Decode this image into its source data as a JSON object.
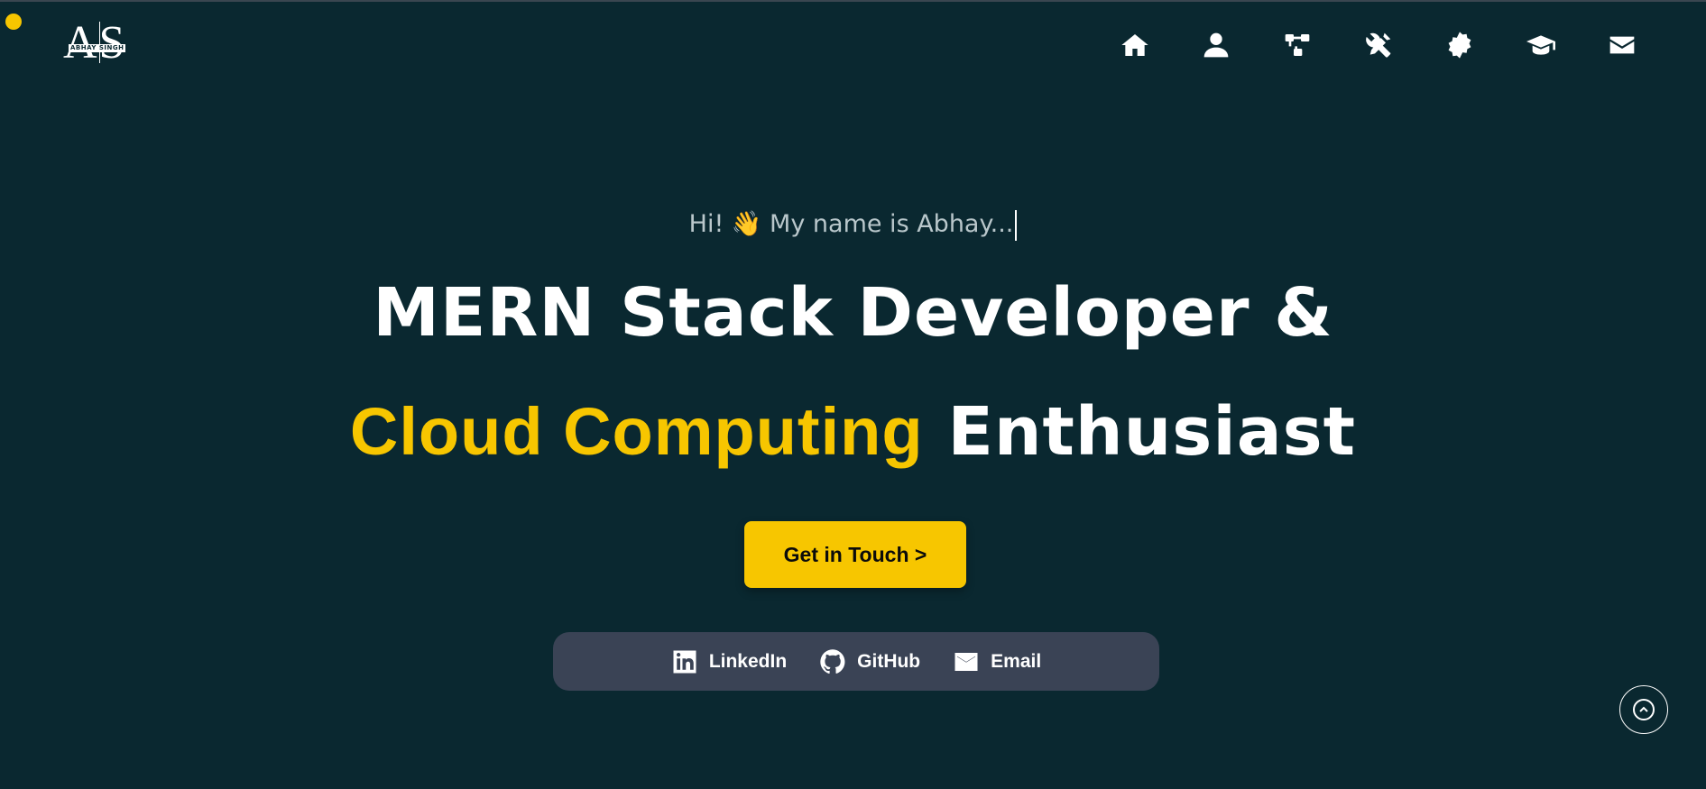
{
  "logo": {
    "letters": "AS",
    "tag": "ABHAY SINGH"
  },
  "nav": {
    "items": [
      {
        "name": "home",
        "icon": "home-icon"
      },
      {
        "name": "about",
        "icon": "user-icon"
      },
      {
        "name": "experience",
        "icon": "sitemap-icon"
      },
      {
        "name": "skills",
        "icon": "tools-icon"
      },
      {
        "name": "certificates",
        "icon": "badge-icon"
      },
      {
        "name": "education",
        "icon": "graduation-cap-icon"
      },
      {
        "name": "contact",
        "icon": "envelope-icon"
      }
    ]
  },
  "hero": {
    "greeting": "Hi! 👋 My name is Abhay...",
    "line1": "MERN Stack Developer &",
    "line2_accent": "Cloud Computing",
    "line2_rest": "Enthusiast",
    "cta_label": "Get in Touch >"
  },
  "socials": {
    "linkedin": "LinkedIn",
    "github": "GitHub",
    "email": "Email"
  },
  "colors": {
    "background": "#0a2830",
    "accent": "#f7c600",
    "socials_bar": "#3a4355"
  }
}
